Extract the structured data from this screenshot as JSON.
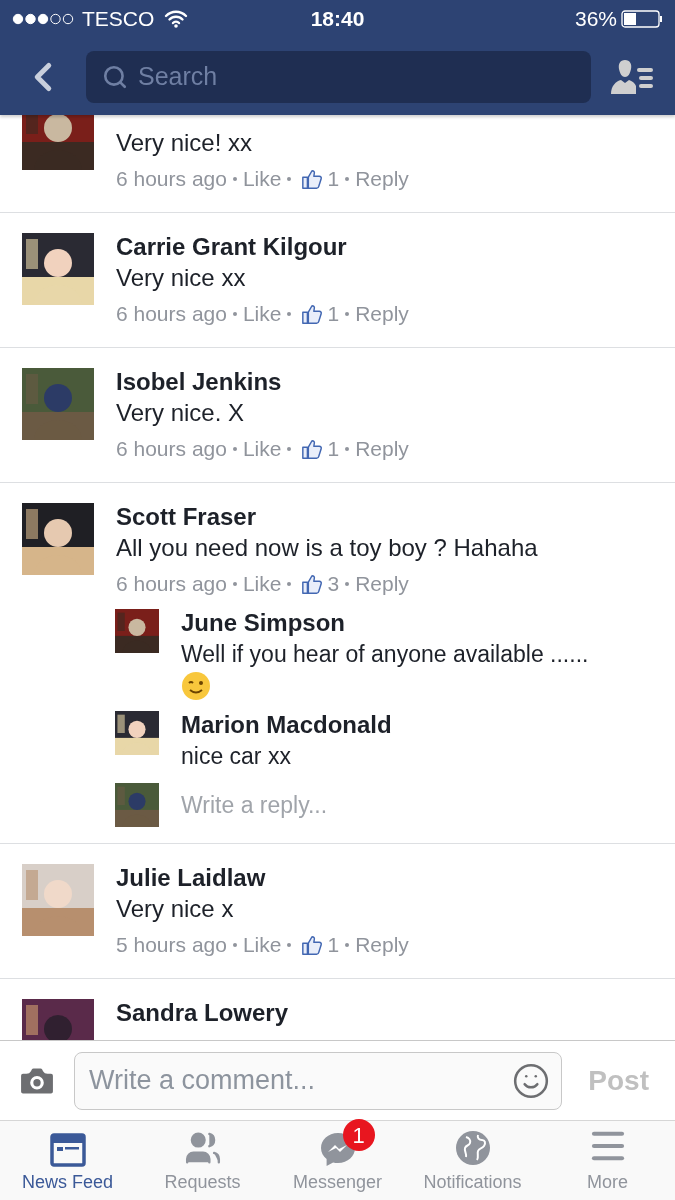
{
  "status_bar": {
    "carrier": "TESCO",
    "time": "18:40",
    "battery": "36%"
  },
  "nav": {
    "search": {
      "placeholder": "Search"
    }
  },
  "comments": [
    {
      "text": "Very nice!  xx",
      "time": "6 hours ago",
      "like": "Like",
      "likes": "1",
      "reply": "Reply"
    },
    {
      "name": "Carrie Grant Kilgour",
      "text": "Very nice xx",
      "time": "6 hours ago",
      "like": "Like",
      "likes": "1",
      "reply": "Reply"
    },
    {
      "name": "Isobel Jenkins",
      "text": "Very nice. X",
      "time": "6 hours ago",
      "like": "Like",
      "likes": "1",
      "reply": "Reply"
    },
    {
      "name": "Scott Fraser",
      "text": "All you need now is a toy boy ? Hahaha",
      "time": "6 hours ago",
      "like": "Like",
      "likes": "3",
      "reply": "Reply",
      "replies": [
        {
          "name": "June Simpson",
          "text": "Well if you hear of anyone available ......",
          "emoji": true
        },
        {
          "name": "Marion Macdonald",
          "text": "nice car xx"
        }
      ],
      "reply_field": {
        "placeholder": "Write a reply..."
      }
    },
    {
      "name": "Julie Laidlaw",
      "text": "Very nice x",
      "time": "5 hours ago",
      "like": "Like",
      "likes": "1",
      "reply": "Reply"
    },
    {
      "name": "Sandra Lowery"
    }
  ],
  "composer": {
    "placeholder": "Write a comment...",
    "post": "Post"
  },
  "tabs": [
    {
      "kind": "feed",
      "label": "News Feed",
      "selected": true
    },
    {
      "kind": "requests",
      "label": "Requests",
      "selected": false
    },
    {
      "kind": "messenger",
      "label": "Messenger",
      "selected": false,
      "badge": "1"
    },
    {
      "kind": "notifications",
      "label": "Notifications",
      "selected": false
    },
    {
      "kind": "more",
      "label": "More",
      "selected": false
    }
  ]
}
